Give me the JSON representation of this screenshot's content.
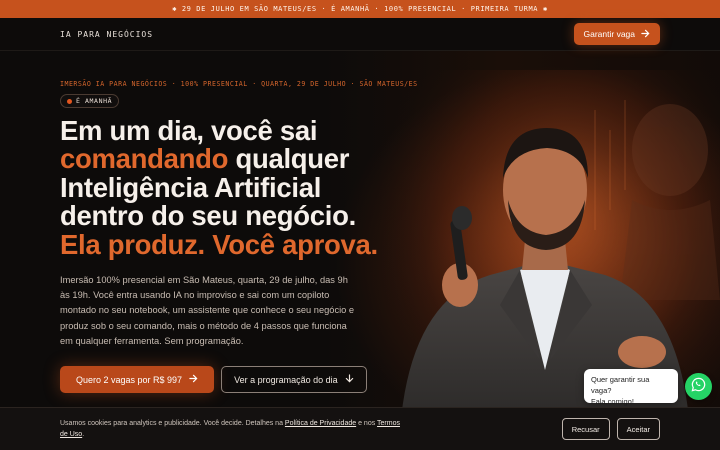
{
  "announcement": "✱ 29 DE JULHO EM SÃO MATEUS/ES · É AMANHÃ · 100% PRESENCIAL · PRIMEIRA TURMA ✱",
  "header": {
    "brand": "IA PARA NEGÓCIOS",
    "cta_label": "Garantir vaga",
    "cta_icon": "arrow-right-icon"
  },
  "hero": {
    "eyebrow": "IMERSÃO IA PARA NEGÓCIOS · 100% PRESENCIAL · QUARTA, 29 DE JULHO · SÃO MATEUS/ES",
    "badge": "É AMANHÃ",
    "headline": {
      "line1": "Em um dia, você sai",
      "line2_accent": "comandando",
      "line2_rest": " qualquer",
      "line3": "Inteligência Artificial",
      "line4": "dentro do seu negócio.",
      "line5_accent": "Ela produz. Você aprova."
    },
    "lead": "Imersão 100% presencial em São Mateus, quarta, 29 de julho, das 9h às 19h. Você entra usando IA no improviso e sai com um copiloto montado no seu notebook, um assistente que conhece o seu negócio e produz sob o seu comando, mais o método de 4 passos que funciona em qualquer ferramenta. Sem programação.",
    "primary_cta": "Quero 2 vagas por R$ 997",
    "secondary_cta": "Ver a programação do dia",
    "primary_icon": "arrow-right-icon",
    "secondary_icon": "arrow-down-icon"
  },
  "whatsapp": {
    "bubble_line1": "Quer garantir sua vaga?",
    "bubble_line2": "Fala comigo!",
    "icon": "whatsapp-icon",
    "color": "#25d366"
  },
  "cookie": {
    "text_before": "Usamos cookies para analytics e publicidade. Você decide. Detalhes na ",
    "privacy_link": "Política de Privacidade",
    "text_middle": " e nos ",
    "terms_link": "Termos de Uso",
    "text_after": ".",
    "reject_label": "Recusar",
    "accept_label": "Aceitar"
  },
  "colors": {
    "accent": "#c6521d",
    "accent_text": "#e0682d",
    "background": "#0d0b0a"
  }
}
